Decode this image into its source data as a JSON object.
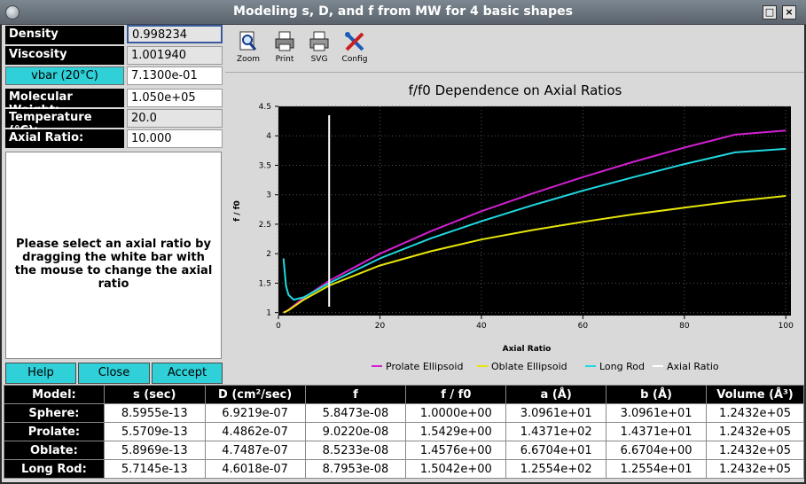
{
  "window": {
    "title": "Modeling s, D, and f from MW for 4 basic shapes"
  },
  "inputs": {
    "density": {
      "label": "Density",
      "value": "0.998234"
    },
    "viscosity": {
      "label": "Viscosity",
      "value": "1.001940"
    },
    "vbar": {
      "label": "vbar (20°C)",
      "value": "7.1300e-01"
    },
    "mw": {
      "label": "Molecular Weight:",
      "value": "1.050e+05"
    },
    "temperature": {
      "label": "Temperature (°C):",
      "value": "20.0"
    },
    "axial": {
      "label": "Axial Ratio:",
      "value": "10.000"
    }
  },
  "message": "Please select an axial ratio by dragging the white bar with the mouse to change the axial ratio",
  "buttons": {
    "help": "Help",
    "close": "Close",
    "accept": "Accept"
  },
  "toolbar": {
    "zoom": "Zoom",
    "print": "Print",
    "svg": "SVG",
    "config": "Config"
  },
  "chart_data": {
    "type": "line",
    "title": "f/f0 Dependence on Axial Ratios",
    "xlabel": "Axial Ratio",
    "ylabel": "f / f0",
    "xlim": [
      0,
      101
    ],
    "ylim": [
      0.95,
      4.5
    ],
    "xticks": [
      0,
      20,
      40,
      60,
      80,
      100
    ],
    "yticks": [
      1,
      1.5,
      2,
      2.5,
      3,
      3.5,
      4,
      4.5
    ],
    "background": "#000000",
    "grid": true,
    "legend_placement": "bottom",
    "marker_x": 10,
    "series": [
      {
        "name": "Prolate Ellipsoid",
        "color": "#d020d0",
        "x": [
          1,
          2,
          5,
          10,
          20,
          30,
          40,
          50,
          60,
          70,
          80,
          90,
          100
        ],
        "y": [
          1.0,
          1.05,
          1.25,
          1.54,
          2.0,
          2.38,
          2.72,
          3.02,
          3.3,
          3.56,
          3.8,
          4.02,
          4.09
        ]
      },
      {
        "name": "Oblate Ellipsoid",
        "color": "#e6e60a",
        "x": [
          1,
          2,
          5,
          10,
          20,
          30,
          40,
          50,
          60,
          70,
          80,
          90,
          100
        ],
        "y": [
          1.0,
          1.04,
          1.22,
          1.46,
          1.8,
          2.04,
          2.24,
          2.4,
          2.54,
          2.67,
          2.78,
          2.89,
          2.98
        ]
      },
      {
        "name": "Long Rod",
        "color": "#20d8e0",
        "x": [
          1,
          1.5,
          2,
          3,
          5,
          10,
          20,
          30,
          40,
          50,
          60,
          70,
          80,
          90,
          100
        ],
        "y": [
          1.92,
          1.45,
          1.3,
          1.22,
          1.26,
          1.5,
          1.92,
          2.26,
          2.55,
          2.82,
          3.07,
          3.3,
          3.52,
          3.72,
          3.78
        ]
      },
      {
        "name": "Axial Ratio",
        "color": "#ffffff",
        "x": [],
        "y": []
      }
    ]
  },
  "table": {
    "headers": [
      "Model:",
      "s (sec)",
      "D (cm²/sec)",
      "f",
      "f / f0",
      "a (Å)",
      "b (Å)",
      "Volume (Å³)"
    ],
    "rows": [
      {
        "model": "Sphere:",
        "cells": [
          "8.5955e-13",
          "6.9219e-07",
          "5.8473e-08",
          "1.0000e+00",
          "3.0961e+01",
          "3.0961e+01",
          "1.2432e+05"
        ]
      },
      {
        "model": "Prolate:",
        "cells": [
          "5.5709e-13",
          "4.4862e-07",
          "9.0220e-08",
          "1.5429e+00",
          "1.4371e+02",
          "1.4371e+01",
          "1.2432e+05"
        ]
      },
      {
        "model": "Oblate:",
        "cells": [
          "5.8969e-13",
          "4.7487e-07",
          "8.5233e-08",
          "1.4576e+00",
          "6.6704e+01",
          "6.6704e+00",
          "1.2432e+05"
        ]
      },
      {
        "model": "Long Rod:",
        "cells": [
          "5.7145e-13",
          "4.6018e-07",
          "8.7953e-08",
          "1.5042e+00",
          "1.2554e+02",
          "1.2554e+01",
          "1.2432e+05"
        ]
      }
    ]
  }
}
